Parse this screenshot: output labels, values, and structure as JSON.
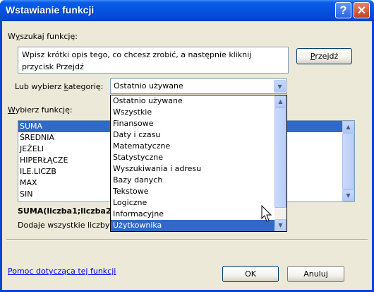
{
  "window": {
    "title": "Wstawianie funkcji",
    "help_glyph": "?",
    "close_glyph": "✕"
  },
  "search": {
    "label_pre": "W",
    "label_u": "y",
    "label_post": "szukaj funkcję:",
    "text": "Wpisz krótki opis tego, co chcesz zrobić, a następnie kliknij przycisk Przejdź",
    "go_pre": "",
    "go_u": "P",
    "go_post": "rzejdź"
  },
  "category": {
    "label_pre": "Lub wybierz ",
    "label_u": "k",
    "label_post": "ategorię:",
    "selected": "Ostatnio używane",
    "options": [
      "Ostatnio używane",
      "Wszystkie",
      "Finansowe",
      "Daty i czasu",
      "Matematyczne",
      "Statystyczne",
      "Wyszukiwania i adresu",
      "Bazy danych",
      "Tekstowe",
      "Logiczne",
      "Informacyjne",
      "Użytkownika"
    ],
    "highlighted_option": "Użytkownika"
  },
  "functions": {
    "label_pre": "",
    "label_u": "W",
    "label_post": "ybierz funkcję:",
    "items": [
      "SUMA",
      "ŚREDNIA",
      "JEŻELI",
      "HIPERŁĄCZE",
      "ILE.LICZB",
      "MAX",
      "SIN"
    ],
    "selected": "SUMA"
  },
  "description": {
    "signature": "SUMA(liczba1;liczba2",
    "text": "Dodaje wszystkie liczby"
  },
  "footer": {
    "help_link": "Pomoc dotycząca tej funkcji",
    "ok": "OK",
    "cancel": "Anuluj"
  },
  "icons": {
    "scroll_up": "▲",
    "scroll_down": "▼",
    "dropdown_arrow": "▼",
    "pointer": "mouse-pointer-icon"
  },
  "colors": {
    "title_bar": "#0553E0",
    "selection": "#316AC5",
    "face": "#ECE9D8",
    "link": "#0000FF"
  }
}
